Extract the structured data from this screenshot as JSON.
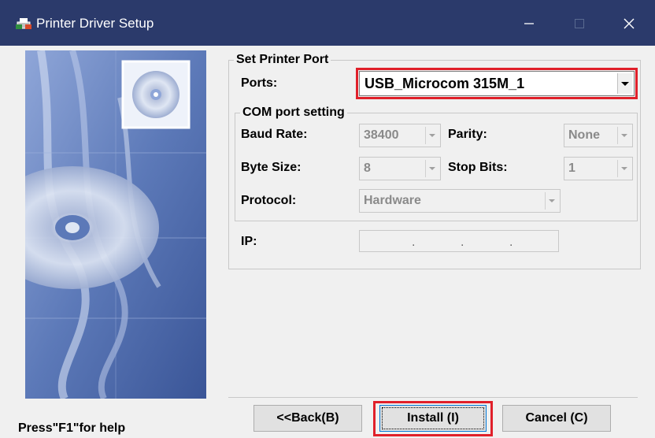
{
  "window": {
    "title": "Printer Driver Setup",
    "icon": "printer-setup-icon"
  },
  "printer_port": {
    "group_title": "Set Printer Port",
    "ports_label": "Ports:",
    "ports_value": "USB_Microcom 315M_1"
  },
  "com_settings": {
    "group_title": "COM port setting",
    "baud_rate_label": "Baud Rate:",
    "baud_rate_value": "38400",
    "parity_label": "Parity:",
    "parity_value": "None",
    "byte_size_label": "Byte Size:",
    "byte_size_value": "8",
    "stop_bits_label": "Stop Bits:",
    "stop_bits_value": "1",
    "protocol_label": "Protocol:",
    "protocol_value": "Hardware"
  },
  "ip": {
    "label": "IP:",
    "dots": [
      ".",
      ".",
      "."
    ]
  },
  "buttons": {
    "back": "<<Back(B)",
    "install": "Install (I)",
    "cancel": "Cancel (C)"
  },
  "help_text": "Press\"F1\"for help",
  "colors": {
    "titlebar": "#2b3a6b",
    "highlight": "#e0202a",
    "background": "#f0f0f0"
  }
}
